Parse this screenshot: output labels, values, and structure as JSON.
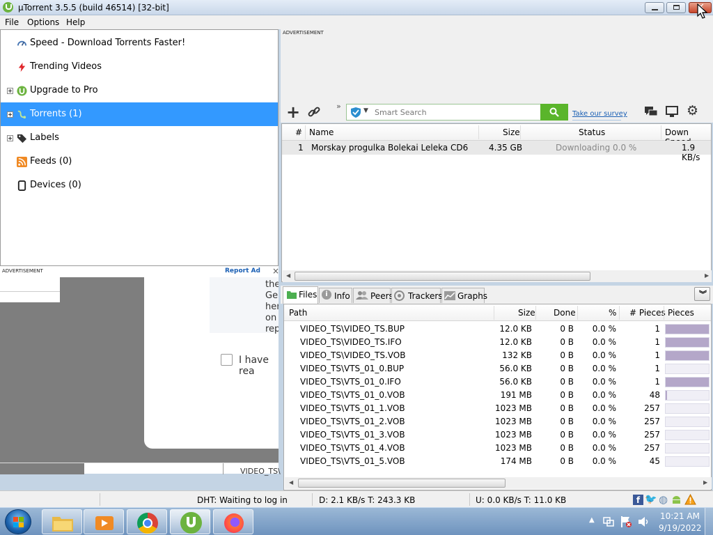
{
  "window": {
    "title": "µTorrent 3.5.5  (build 46514) [32-bit]"
  },
  "menu": [
    "File",
    "Options",
    "Help"
  ],
  "sidebar": {
    "items": [
      {
        "label": "Speed - Download Torrents Faster!",
        "icon": "speedometer-icon"
      },
      {
        "label": "Trending Videos",
        "icon": "lightning-icon"
      },
      {
        "label": "Upgrade to Pro",
        "icon": "utorrent-logo-icon"
      },
      {
        "label": "Torrents (1)",
        "icon": "torrents-icon"
      },
      {
        "label": "Labels",
        "icon": "tag-icon"
      },
      {
        "label": "Feeds (0)",
        "icon": "rss-icon"
      },
      {
        "label": "Devices (0)",
        "icon": "device-icon"
      }
    ]
  },
  "ads": {
    "top_label": "ADVERTISEMENT",
    "side_label": "ADVERTISEMENT",
    "report": "Report Ad",
    "close": "×",
    "fragments": [
      "the",
      "Ge",
      "her",
      "on",
      "rep"
    ],
    "checkbox_text": "I have rea",
    "behind_text": "VIDEO_TS\\"
  },
  "toolbar": {
    "search_placeholder": "Smart Search",
    "survey": "Take our survey",
    "overflow": "»"
  },
  "torrents": {
    "columns": [
      "#",
      "Name",
      "Size",
      "Status",
      "Down Speed"
    ],
    "rows": [
      {
        "num": "1",
        "name": "Morskay progulka Bolekai Leleka CD6",
        "size": "4.35 GB",
        "status": "Downloading 0.0 %",
        "speed": "1.9 KB/s"
      }
    ]
  },
  "tabs": [
    "Files",
    "Info",
    "Peers",
    "Trackers",
    "Graphs"
  ],
  "files": {
    "columns": [
      "Path",
      "Size",
      "Done",
      "%",
      "# Pieces",
      "Pieces"
    ],
    "rows": [
      {
        "path": "VIDEO_TS\\VIDEO_TS.BUP",
        "size": "12.0 KB",
        "done": "0 B",
        "pct": "0.0 %",
        "pieces": "1",
        "fill": 1.0
      },
      {
        "path": "VIDEO_TS\\VIDEO_TS.IFO",
        "size": "12.0 KB",
        "done": "0 B",
        "pct": "0.0 %",
        "pieces": "1",
        "fill": 1.0
      },
      {
        "path": "VIDEO_TS\\VIDEO_TS.VOB",
        "size": "132 KB",
        "done": "0 B",
        "pct": "0.0 %",
        "pieces": "1",
        "fill": 1.0
      },
      {
        "path": "VIDEO_TS\\VTS_01_0.BUP",
        "size": "56.0 KB",
        "done": "0 B",
        "pct": "0.0 %",
        "pieces": "1",
        "fill": 0.0
      },
      {
        "path": "VIDEO_TS\\VTS_01_0.IFO",
        "size": "56.0 KB",
        "done": "0 B",
        "pct": "0.0 %",
        "pieces": "1",
        "fill": 1.0
      },
      {
        "path": "VIDEO_TS\\VTS_01_0.VOB",
        "size": "191 MB",
        "done": "0 B",
        "pct": "0.0 %",
        "pieces": "48",
        "fill": 0.04
      },
      {
        "path": "VIDEO_TS\\VTS_01_1.VOB",
        "size": "1023 MB",
        "done": "0 B",
        "pct": "0.0 %",
        "pieces": "257",
        "fill": 0.0
      },
      {
        "path": "VIDEO_TS\\VTS_01_2.VOB",
        "size": "1023 MB",
        "done": "0 B",
        "pct": "0.0 %",
        "pieces": "257",
        "fill": 0.0
      },
      {
        "path": "VIDEO_TS\\VTS_01_3.VOB",
        "size": "1023 MB",
        "done": "0 B",
        "pct": "0.0 %",
        "pieces": "257",
        "fill": 0.0
      },
      {
        "path": "VIDEO_TS\\VTS_01_4.VOB",
        "size": "1023 MB",
        "done": "0 B",
        "pct": "0.0 %",
        "pieces": "257",
        "fill": 0.0
      },
      {
        "path": "VIDEO_TS\\VTS_01_5.VOB",
        "size": "174 MB",
        "done": "0 B",
        "pct": "0.0 %",
        "pieces": "45",
        "fill": 0.0
      }
    ]
  },
  "status": {
    "dht": "DHT: Waiting to log in",
    "down": "D: 2.1 KB/s T: 243.3 KB",
    "up": "U: 0.0 KB/s T: 11.0 KB"
  },
  "taskbar": {
    "time": "10:21 AM",
    "date": "9/19/2022"
  },
  "colors": {
    "selection": "#3399ff",
    "search_button": "#5ab52b",
    "piece_fill": "#b4a7c9"
  }
}
